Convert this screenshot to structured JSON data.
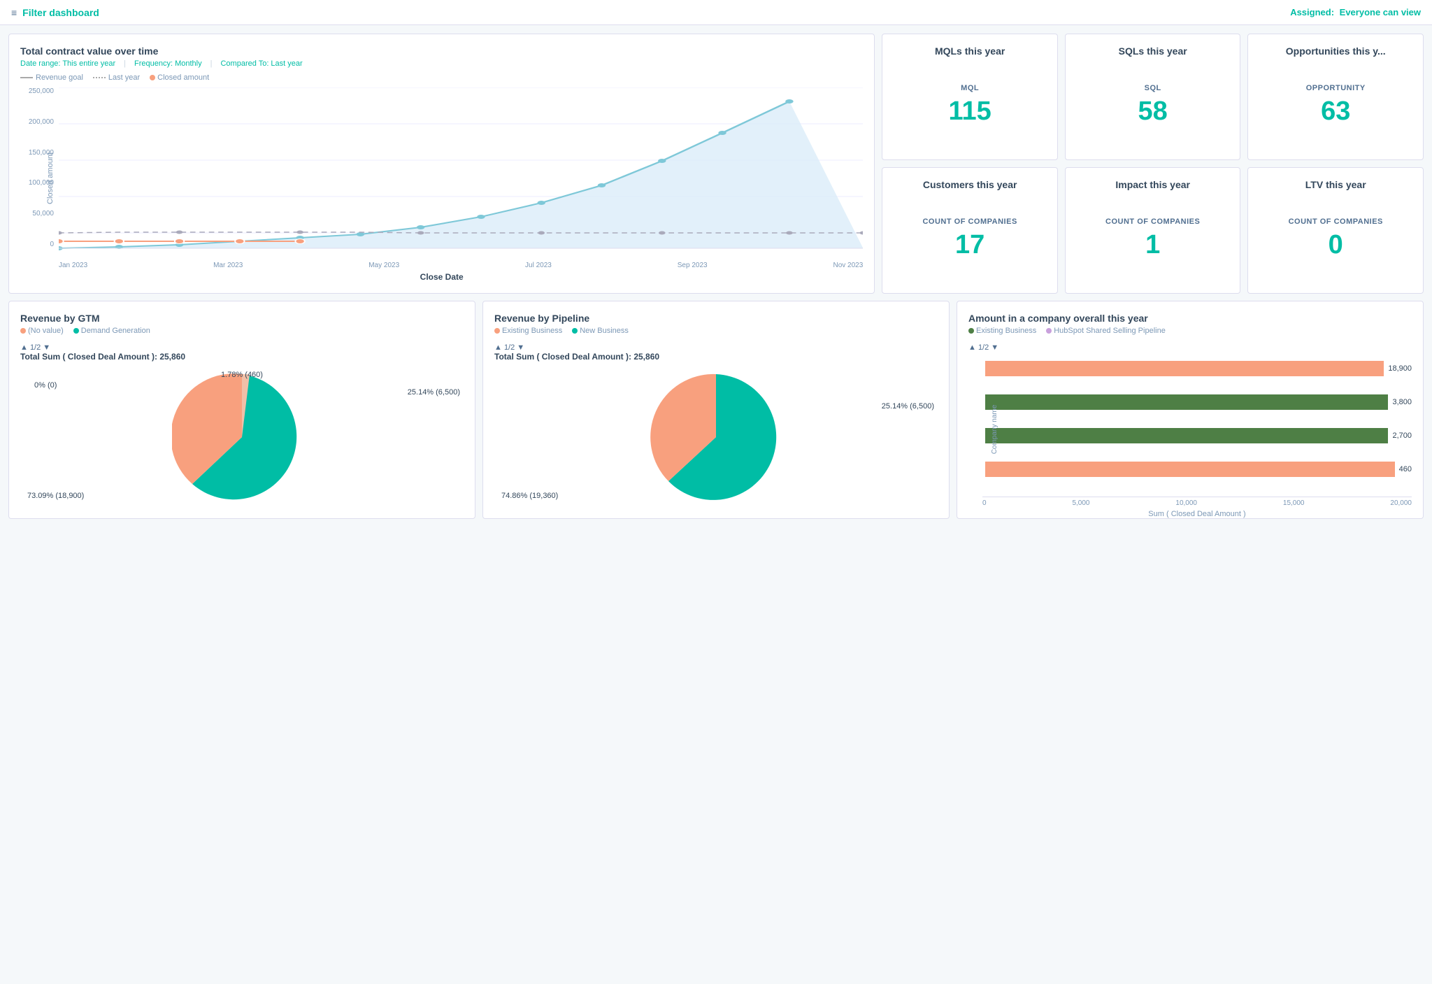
{
  "topbar": {
    "filter_icon": "≡",
    "title": "Filter dashboard",
    "assigned_label": "Assigned:",
    "assigned_value": "Everyone can view"
  },
  "charts": {
    "total_contract": {
      "title": "Total contract value over time",
      "date_range": "Date range: This entire year",
      "frequency": "Frequency: Monthly",
      "compared_to": "Compared To: Last year",
      "legend": [
        {
          "label": "Revenue goal",
          "color": "#aab"
        },
        {
          "label": "Last year",
          "color": "#aab"
        },
        {
          "label": "Closed amount",
          "color": "#f8a07e"
        }
      ],
      "x_label": "Close Date",
      "y_label": "Closed amount",
      "y_ticks": [
        "250,000",
        "200,000",
        "150,000",
        "100,000",
        "50,000",
        "0"
      ],
      "x_ticks": [
        "Jan 2023",
        "Mar 2023",
        "May 2023",
        "Jul 2023",
        "Sep 2023",
        "Nov 2023"
      ]
    },
    "mqls": {
      "title": "MQLs this year",
      "label": "MQL",
      "value": "115"
    },
    "sqls": {
      "title": "SQLs this year",
      "label": "SQL",
      "value": "58"
    },
    "opportunities": {
      "title": "Opportunities this y...",
      "label": "OPPORTUNITY",
      "value": "63"
    },
    "customers": {
      "title": "Customers this year",
      "label": "COUNT OF COMPANIES",
      "value": "17"
    },
    "impact": {
      "title": "Impact this year",
      "label": "COUNT OF COMPANIES",
      "value": "1"
    },
    "ltv": {
      "title": "LTV this year",
      "label": "COUNT OF COMPANIES",
      "value": "0"
    },
    "revenue_gtm": {
      "title": "Revenue by GTM",
      "legend": [
        {
          "label": "(No value)",
          "color": "#f8a07e"
        },
        {
          "label": "Demand Generation",
          "color": "#00bda5"
        }
      ],
      "pagination": "▲ 1/2 ▼",
      "summary": "Total Sum ( Closed Deal Amount ): 25,860",
      "segments": [
        {
          "label": "73.09% (18,900)",
          "pct": 73.09,
          "color": "#00bda5"
        },
        {
          "label": "25.14% (6,500)",
          "pct": 25.14,
          "color": "#f8a07e"
        },
        {
          "label": "1.78% (460)",
          "pct": 1.78,
          "color": "#f0c0a8"
        },
        {
          "label": "0% (0)",
          "pct": 0,
          "color": "#aaa"
        }
      ]
    },
    "revenue_pipeline": {
      "title": "Revenue by Pipeline",
      "legend": [
        {
          "label": "Existing Business",
          "color": "#f8a07e"
        },
        {
          "label": "New Business",
          "color": "#00bda5"
        }
      ],
      "pagination": "▲ 1/2 ▼",
      "summary": "Total Sum ( Closed Deal Amount ): 25,860",
      "segments": [
        {
          "label": "74.86% (19,360)",
          "pct": 74.86,
          "color": "#00bda5"
        },
        {
          "label": "25.14% (6,500)",
          "pct": 25.14,
          "color": "#f8a07e"
        }
      ]
    },
    "amount_company": {
      "title": "Amount in a company overall this year",
      "legend": [
        {
          "label": "Existing Business",
          "color": "#4e7f45"
        },
        {
          "label": "HubSpot Shared Selling Pipeline",
          "color": "#c9a0dc"
        }
      ],
      "pagination": "▲ 1/2 ▼",
      "x_label": "Sum ( Closed Deal Amount )",
      "y_label": "Company name",
      "x_ticks": [
        "0",
        "5,000",
        "10,000",
        "15,000",
        "20,000"
      ],
      "bars": [
        {
          "value": 18900,
          "label": "18,900",
          "color": "#f8a07e",
          "max": 20000
        },
        {
          "value": 3800,
          "label": "3,800",
          "color": "#4e7f45",
          "max": 20000
        },
        {
          "value": 2700,
          "label": "2,700",
          "color": "#4e7f45",
          "max": 20000
        },
        {
          "value": 460,
          "label": "460",
          "color": "#f8a07e",
          "max": 20000
        }
      ]
    }
  }
}
